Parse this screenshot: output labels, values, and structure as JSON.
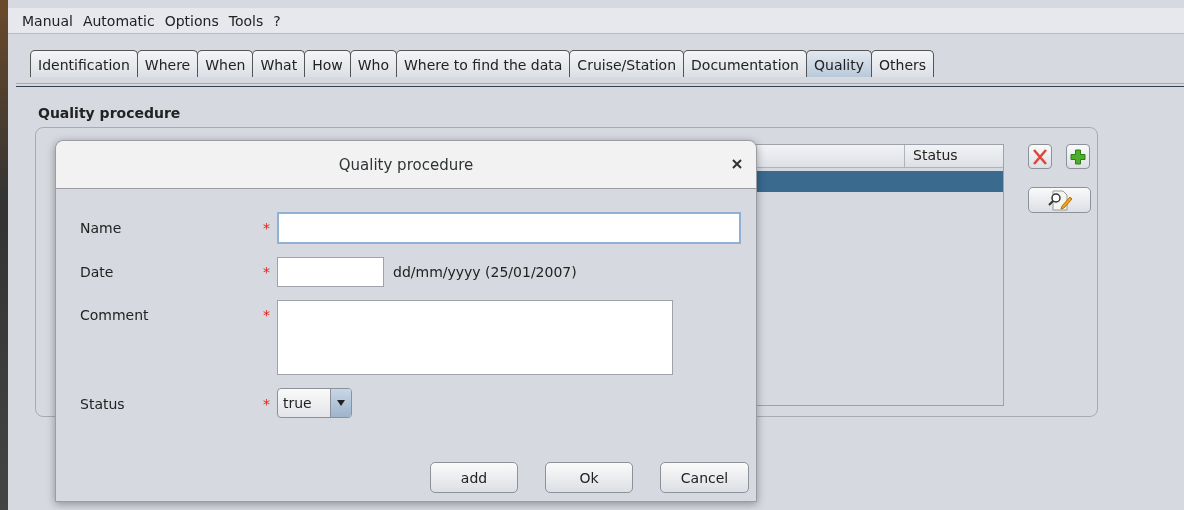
{
  "menu": [
    "Manual",
    "Automatic",
    "Options",
    "Tools",
    "?"
  ],
  "tabs": [
    {
      "label": "Identification",
      "selected": false
    },
    {
      "label": "Where",
      "selected": false
    },
    {
      "label": "When",
      "selected": false
    },
    {
      "label": "What",
      "selected": false
    },
    {
      "label": "How",
      "selected": false
    },
    {
      "label": "Who",
      "selected": false
    },
    {
      "label": "Where to find the data",
      "selected": false
    },
    {
      "label": "Cruise/Station",
      "selected": false
    },
    {
      "label": "Documentation",
      "selected": false
    },
    {
      "label": "Quality",
      "selected": true
    },
    {
      "label": "Others",
      "selected": false
    }
  ],
  "section": {
    "title": "Quality procedure",
    "table": {
      "columns": [
        "Status"
      ],
      "rows": [
        {
          "selected": true
        }
      ]
    }
  },
  "dialog": {
    "title": "Quality procedure",
    "fields": [
      {
        "kind": "text",
        "label": "Name",
        "marker": "*",
        "focused": true
      },
      {
        "kind": "date",
        "label": "Date",
        "marker": "*",
        "hint": "dd/mm/yyyy (25/01/2007)",
        "focused": false
      },
      {
        "kind": "textarea",
        "label": "Comment",
        "marker": "*",
        "focused": false
      },
      {
        "kind": "select",
        "label": "Status",
        "marker": "*",
        "value": "true",
        "focused": false
      }
    ],
    "buttons": [
      "add",
      "Ok",
      "Cancel"
    ]
  }
}
